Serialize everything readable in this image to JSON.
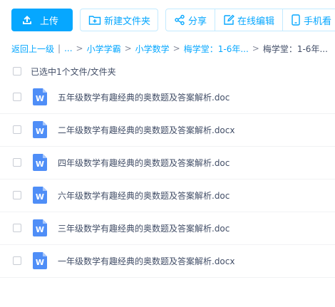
{
  "toolbar": {
    "upload_label": "上传",
    "new_folder_label": "新建文件夹",
    "share_label": "分享",
    "online_edit_label": "在线编辑",
    "mobile_view_label": "手机看"
  },
  "breadcrumb": {
    "back": "返回上一级",
    "ellipsis": "...",
    "items": [
      "小学学霸",
      "小学数学",
      "梅学堂：1-6年..."
    ],
    "current": "梅学堂：1-6年..."
  },
  "selection": {
    "summary": "已选中1个文件/文件夹"
  },
  "files": [
    {
      "name": "五年级数学有趣经典的奥数题及答案解析.doc"
    },
    {
      "name": "二年级数学有趣经典的奥数题及答案解析.docx"
    },
    {
      "name": "四年级数学有趣经典的奥数题及答案解析.doc"
    },
    {
      "name": "六年级数学有趣经典的奥数题及答案解析.doc"
    },
    {
      "name": "三年级数学有趣经典的奥数题及答案解析.doc"
    },
    {
      "name": "一年级数学有趣经典的奥数题及答案解析.docx"
    }
  ],
  "colors": {
    "accent": "#06a7ff",
    "word_icon": "#4f8ef7"
  },
  "icons": {
    "upload": "upload-icon",
    "new_folder": "folder-plus-icon",
    "share": "share-icon",
    "edit": "edit-icon",
    "mobile": "phone-icon",
    "file": "word-doc-icon"
  }
}
